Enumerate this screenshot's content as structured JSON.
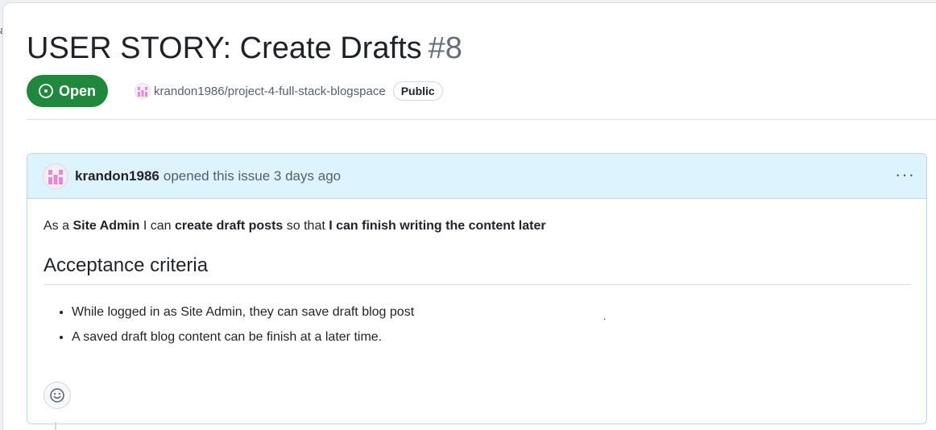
{
  "issue": {
    "title": "USER STORY: Create Drafts",
    "number": "#8",
    "state_label": "Open",
    "repo": "krandon1986/project-4-full-stack-blogspace",
    "visibility": "Public"
  },
  "comment": {
    "author": "krandon1986",
    "opened_text": "opened this issue 3 days ago",
    "menu_glyph": "···",
    "story": {
      "prefix": "As a",
      "role": "Site Admin",
      "mid1": "I can",
      "action": "create draft posts",
      "mid2": "so that",
      "benefit": "I can finish writing the content later"
    },
    "heading": "Acceptance criteria",
    "criteria": [
      "While logged in as Site Admin, they can save draft blog post",
      "A saved draft blog content can be finish at a later time."
    ],
    "stray_mark": "."
  },
  "edge_glyph": "a",
  "colors": {
    "open_green": "#1f883d",
    "comment_header_bg": "#ddf4ff",
    "comment_border": "#b6d8f2"
  },
  "icons": [
    "issue-open-icon",
    "repo-owner-avatar",
    "author-avatar",
    "kebab-menu-icon",
    "smiley-icon"
  ]
}
